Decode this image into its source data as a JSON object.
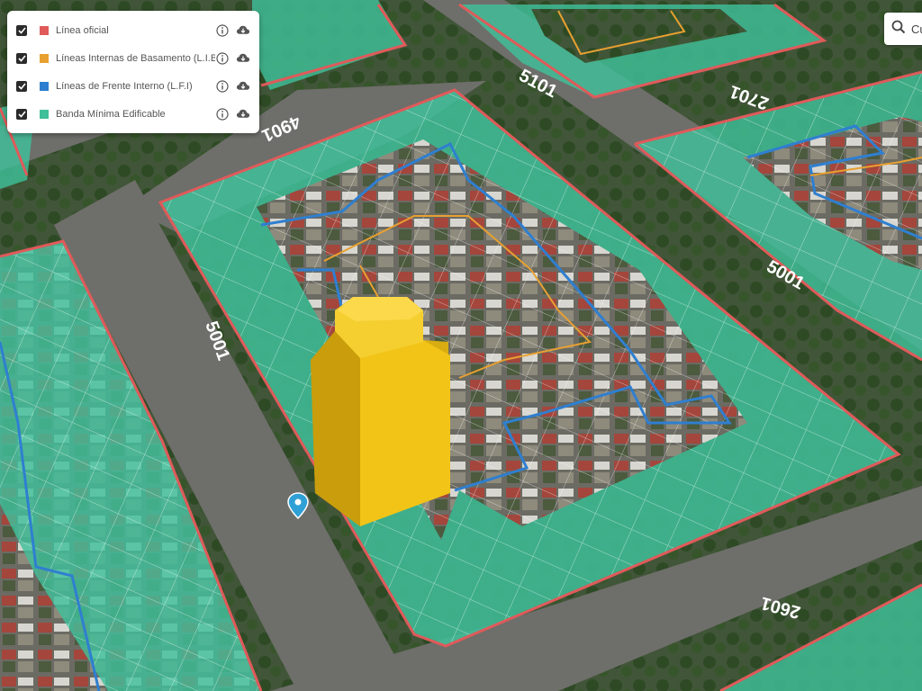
{
  "layers": [
    {
      "id": "linea-oficial",
      "label": "Línea oficial",
      "checked": true,
      "color": "#e05a5a"
    },
    {
      "id": "lineas-internas-basamento",
      "label": "Líneas Internas de Basamento (L.I.B)",
      "checked": true,
      "color": "#e8a030"
    },
    {
      "id": "lineas-frente-interno",
      "label": "Líneas de Frente Interno (L.F.I)",
      "checked": true,
      "color": "#2f7fd0"
    },
    {
      "id": "banda-minima-edificable",
      "label": "Banda Mínima Edificable",
      "checked": true,
      "color": "#3fbf9a"
    }
  ],
  "layer_icons": {
    "info": "info-circle-icon",
    "download": "cloud-download-icon"
  },
  "search": {
    "placeholder": "Cu",
    "icon": "search-icon"
  },
  "map": {
    "street_numbers": [
      "4901",
      "5101",
      "2701",
      "5001",
      "5001",
      "2601",
      "4901"
    ],
    "colors": {
      "official_line": "#e05a5a",
      "basement_lines": "#e8a030",
      "inner_front_lines": "#2f7fd0",
      "buildable_band": "#3fbf9a",
      "volume": "#f2c418",
      "marker": "#2fa0d6",
      "aerial_base": "#3d4b3a",
      "street": "#6e6e6a"
    }
  }
}
